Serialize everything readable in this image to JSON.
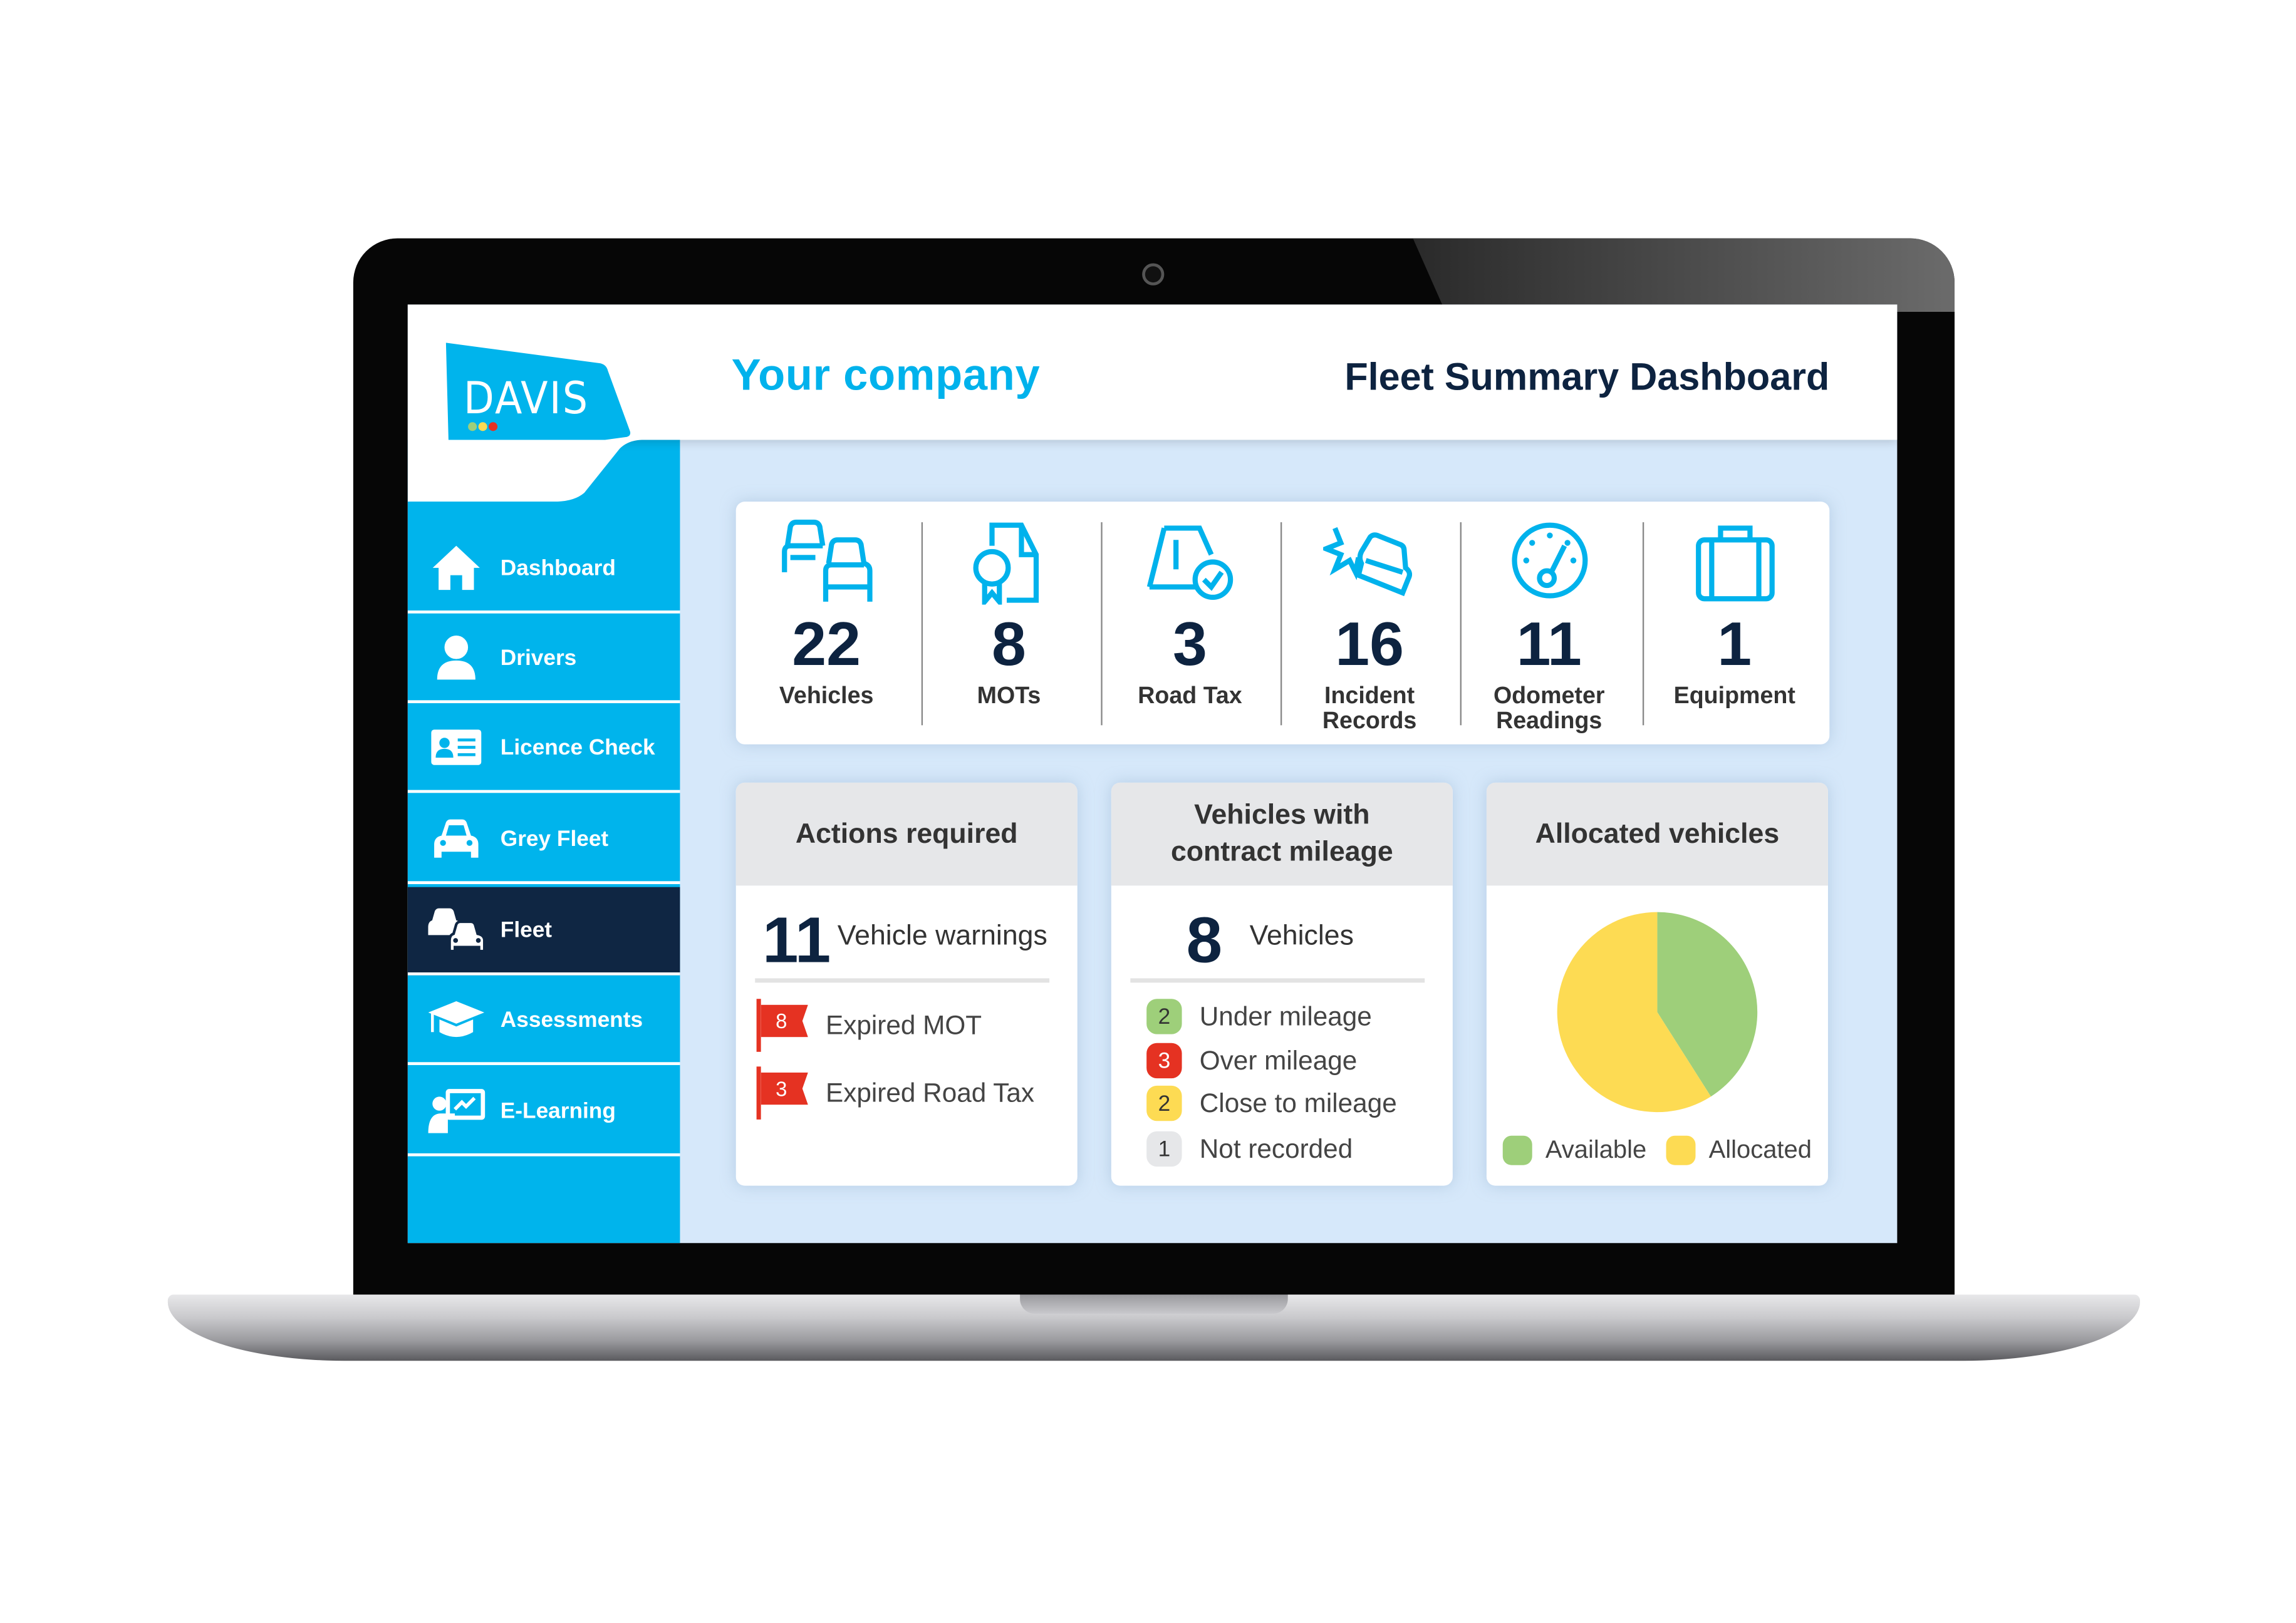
{
  "header": {
    "brand": "DAVIS",
    "company": "Your company",
    "title": "Fleet Summary Dashboard"
  },
  "sidebar": {
    "items": [
      {
        "label": "Dashboard",
        "icon": "home-icon",
        "active": false
      },
      {
        "label": "Drivers",
        "icon": "user-icon",
        "active": false
      },
      {
        "label": "Licence Check",
        "icon": "id-card-icon",
        "active": false
      },
      {
        "label": "Grey Fleet",
        "icon": "car-icon",
        "active": false
      },
      {
        "label": "Fleet",
        "icon": "cars-icon",
        "active": true
      },
      {
        "label": "Assessments",
        "icon": "graduation-cap-icon",
        "active": false
      },
      {
        "label": "E-Learning",
        "icon": "presentation-icon",
        "active": false
      }
    ]
  },
  "stats": [
    {
      "value": "22",
      "label": "Vehicles",
      "icon": "cars-icon"
    },
    {
      "value": "8",
      "label": "MOTs",
      "icon": "certificate-icon"
    },
    {
      "value": "3",
      "label": "Road Tax",
      "icon": "tax-disc-check-icon"
    },
    {
      "value": "16",
      "label": "Incident Records",
      "icon": "car-crash-icon"
    },
    {
      "value": "11",
      "label": "Odometer Readings",
      "icon": "gauge-icon"
    },
    {
      "value": "1",
      "label": "Equipment",
      "icon": "briefcase-icon"
    }
  ],
  "actions": {
    "title": "Actions required",
    "count": "11",
    "count_label": "Vehicle warnings",
    "items": [
      {
        "count": "8",
        "label": "Expired MOT"
      },
      {
        "count": "3",
        "label": "Expired Road Tax"
      }
    ]
  },
  "mileage": {
    "title": "Vehicles with contract mileage",
    "count": "8",
    "count_label": "Vehicles",
    "items": [
      {
        "count": "2",
        "label": "Under mileage",
        "color": "#9ecf7a"
      },
      {
        "count": "3",
        "label": "Over mileage",
        "color": "#e53222"
      },
      {
        "count": "2",
        "label": "Close to mileage",
        "color": "#fddb53"
      },
      {
        "count": "1",
        "label": "Not recorded",
        "color": "#e6e7e9"
      }
    ]
  },
  "allocated": {
    "title": "Allocated vehicles",
    "chart_data": {
      "type": "pie",
      "categories": [
        "Available",
        "Allocated"
      ],
      "values": [
        41,
        59
      ],
      "colors": [
        "#9ecf7a",
        "#fddb53"
      ],
      "legend": "bottom"
    }
  },
  "colors": {
    "brand": "#00b4ec",
    "navy": "#0f2643",
    "background": "#d6e8fa",
    "alert": "#e53222"
  }
}
